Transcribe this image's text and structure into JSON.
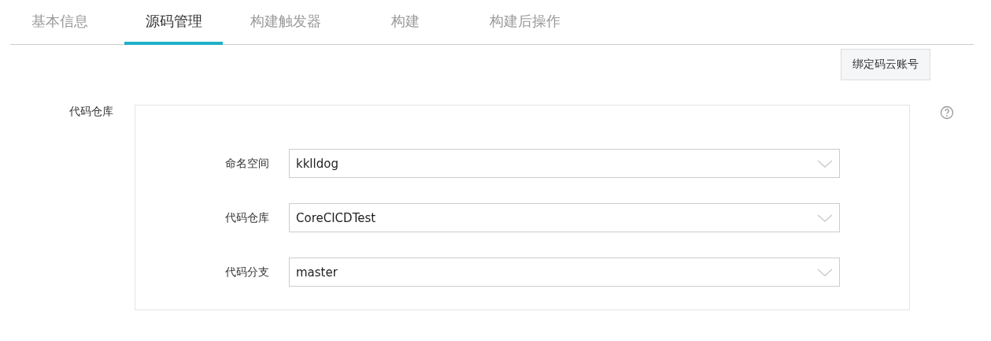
{
  "tabs": [
    {
      "label": "基本信息",
      "selected": false
    },
    {
      "label": "源码管理",
      "selected": true
    },
    {
      "label": "构建触发器",
      "selected": false
    },
    {
      "label": "构建",
      "selected": false
    },
    {
      "label": "构建后操作",
      "selected": false
    }
  ],
  "bind_button": "绑定码云账号",
  "section": {
    "label": "代码仓库",
    "fields": [
      {
        "label": "命名空间",
        "value": "kklldog"
      },
      {
        "label": "代码仓库",
        "value": "CoreCICDTest"
      },
      {
        "label": "代码分支",
        "value": "master"
      }
    ]
  }
}
